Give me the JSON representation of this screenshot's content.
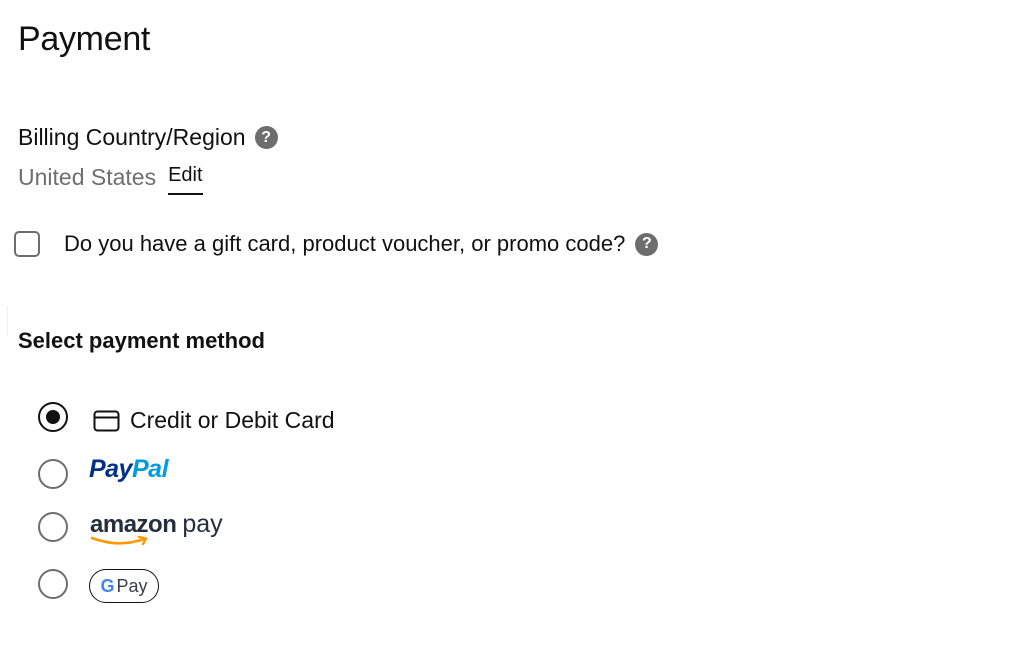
{
  "page": {
    "title": "Payment"
  },
  "billing": {
    "label": "Billing Country/Region",
    "help_glyph": "?",
    "country": "United States",
    "edit_label": "Edit"
  },
  "gift": {
    "label": "Do you have a gift card, product voucher, or promo code?",
    "help_glyph": "?",
    "checked": false
  },
  "payment": {
    "section_title": "Select payment method",
    "options": [
      {
        "id": "card",
        "label": "Credit or Debit Card",
        "icon": "credit-card-icon",
        "selected": true
      },
      {
        "id": "paypal",
        "label_part1": "Pay",
        "label_part2": "Pal",
        "selected": false
      },
      {
        "id": "amazon",
        "label_part1": "amazon",
        "label_part2": "pay",
        "selected": false
      },
      {
        "id": "gpay",
        "label_g": "G",
        "label_pay": "Pay",
        "selected": false
      }
    ]
  },
  "colors": {
    "text": "#111111",
    "muted": "#6f6f6f",
    "help_bg": "#6d6d6d",
    "paypal_dark": "#003087",
    "paypal_light": "#009cde",
    "amazon_text": "#232f3e",
    "amazon_smile": "#ff9900",
    "google_blue": "#4285f4",
    "google_red": "#ea4335",
    "google_yellow": "#fbbc05",
    "google_green": "#34a853"
  }
}
